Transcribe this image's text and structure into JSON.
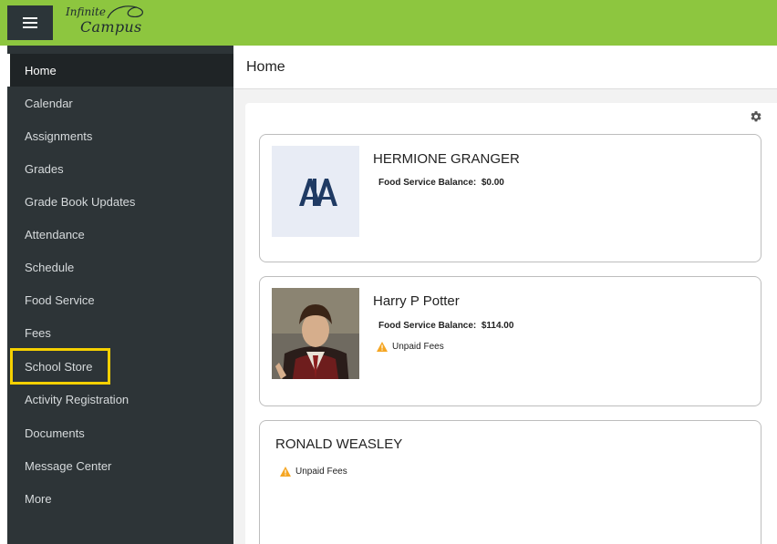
{
  "app": {
    "logo_line1": "Infinite",
    "logo_line2": "Campus"
  },
  "sidebar": {
    "items": [
      {
        "label": "Home",
        "active": true
      },
      {
        "label": "Calendar"
      },
      {
        "label": "Assignments"
      },
      {
        "label": "Grades"
      },
      {
        "label": "Grade Book Updates"
      },
      {
        "label": "Attendance"
      },
      {
        "label": "Schedule"
      },
      {
        "label": "Food Service"
      },
      {
        "label": "Fees"
      },
      {
        "label": "School Store",
        "highlighted": true
      },
      {
        "label": "Activity Registration"
      },
      {
        "label": "Documents"
      },
      {
        "label": "Message Center"
      },
      {
        "label": "More"
      }
    ]
  },
  "main": {
    "title": "Home",
    "students": [
      {
        "name": "HERMIONE GRANGER",
        "balance_label": "Food Service Balance:",
        "balance_value": "$0.00",
        "photo": "school-logo"
      },
      {
        "name": "Harry P Potter",
        "balance_label": "Food Service Balance:",
        "balance_value": "$114.00",
        "fees_text": "Unpaid Fees",
        "photo": "student-photo"
      },
      {
        "name": "RONALD WEASLEY",
        "fees_text": "Unpaid Fees"
      }
    ]
  },
  "colors": {
    "topbar": "#8dc63f",
    "sidebar": "#2d3437",
    "highlight": "#f5d000",
    "warning": "#f5a623"
  },
  "icons": {
    "menu": "hamburger-icon",
    "settings": "gear-icon",
    "warning": "warning-icon"
  }
}
